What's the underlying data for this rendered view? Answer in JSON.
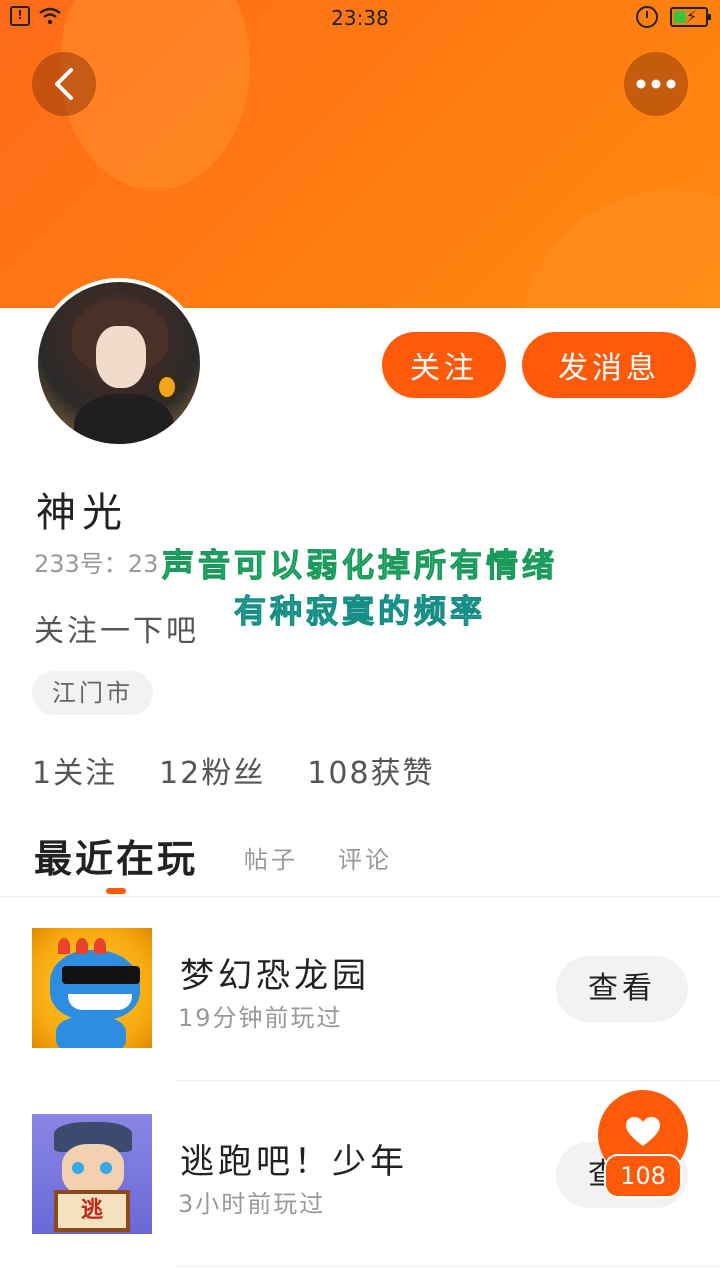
{
  "status_bar": {
    "time": "23:38",
    "icons": [
      "sim-alert-icon",
      "wifi-icon",
      "alarm-icon",
      "battery-charging-icon"
    ],
    "sim_glyph": "!"
  },
  "header": {
    "back_icon": "back-arrow-icon",
    "more_icon": "more-dots-icon",
    "accent_color": "#ff6a1a"
  },
  "profile": {
    "name": "神光",
    "account_id": "233号：23",
    "overlay_line_1": "声音可以弱化掉所有情绪",
    "overlay_line_2": "有种寂寞的频率",
    "bio": "关注一下吧",
    "location": "江门市",
    "follow_label": "关注",
    "message_label": "发消息"
  },
  "stats": {
    "following": "1关注",
    "fans": "12粉丝",
    "likes": "108获赞"
  },
  "tabs": [
    {
      "label": "最近在玩",
      "active": true
    },
    {
      "label": "帖子",
      "active": false
    },
    {
      "label": "评论",
      "active": false
    }
  ],
  "games": [
    {
      "title": "梦幻恐龙园",
      "time": "19分钟前玩过",
      "action": "查看",
      "icon": "dinosaur-game-icon"
    },
    {
      "title": "逃跑吧！少年",
      "time": "3小时前玩过",
      "action": "查看",
      "icon": "runner-game-icon",
      "sign": "逃"
    }
  ],
  "like_fab": {
    "icon": "heart-icon",
    "count": "108"
  },
  "colors": {
    "primary": "#ff5a0a",
    "overlay_green": "#3ad48a",
    "overlay_cyan": "#38c9c0"
  }
}
